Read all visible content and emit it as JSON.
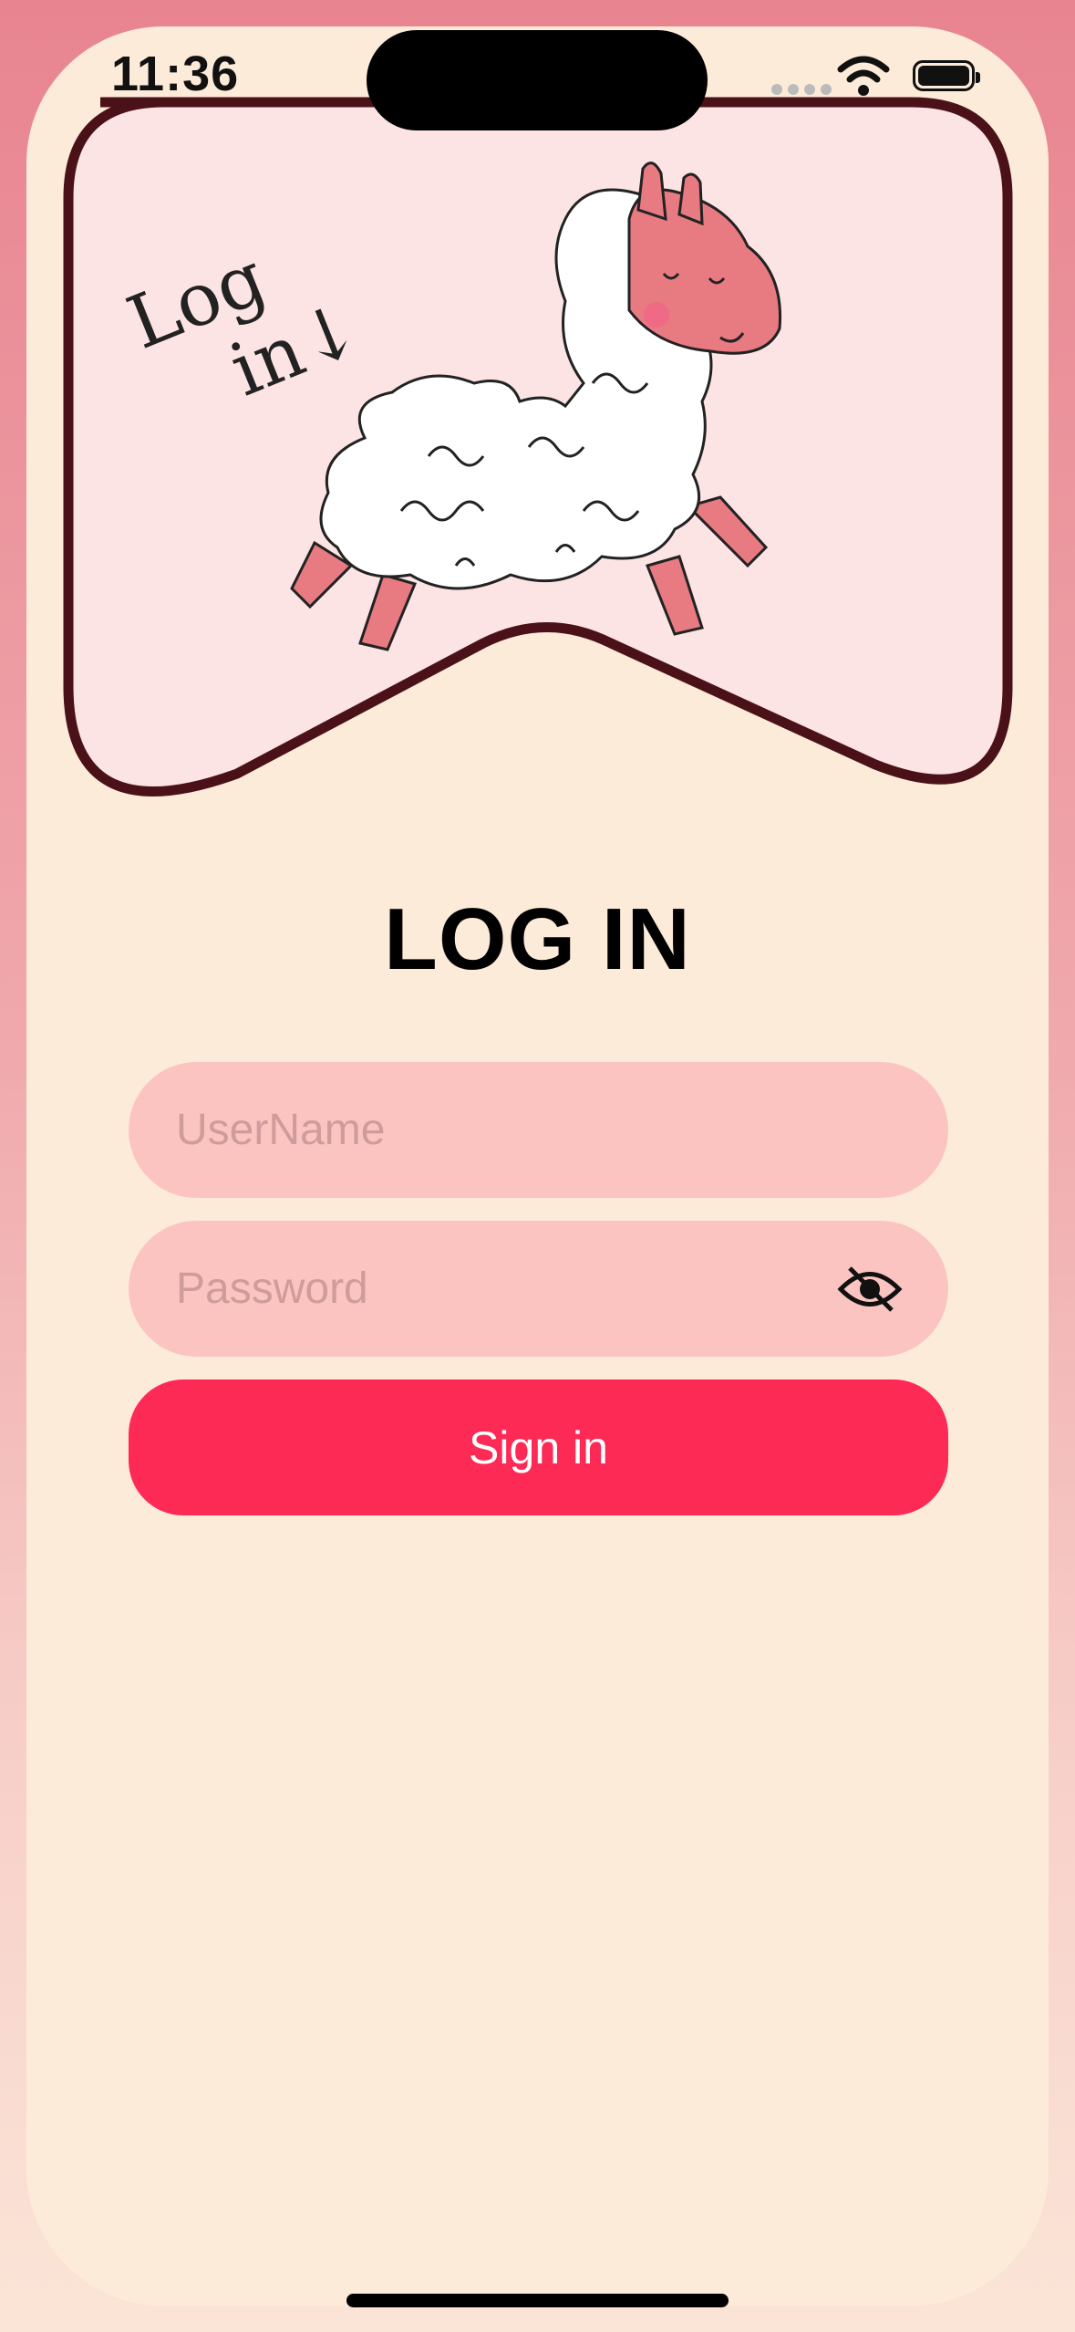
{
  "status_bar": {
    "time": "11:36"
  },
  "header": {
    "art_text_line1": "Log",
    "art_text_line2": "in↓"
  },
  "login": {
    "title": "LOG IN",
    "username_placeholder": "UserName",
    "password_placeholder": "Password",
    "sign_in_label": "Sign in"
  },
  "colors": {
    "background": "#fdebd9",
    "field": "#fcc4c1",
    "accent": "#fe2a56",
    "frame": "#e88490",
    "header_panel": "#fde4e4",
    "header_border": "#4a1118"
  }
}
